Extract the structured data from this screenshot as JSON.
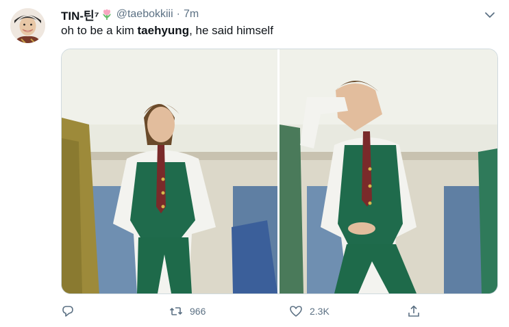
{
  "tweet": {
    "display_name": "TIN-틴⁷",
    "handle": "@taebokkiii",
    "separator": "·",
    "time": "7m",
    "text_before": "oh to be a kim ",
    "text_bold": "taehyung",
    "text_after": ", he said himself"
  },
  "actions": {
    "reply_count": "",
    "retweet_count": "966",
    "like_count": "2.3K",
    "share_count": ""
  },
  "icons": {
    "avatar": "user-avatar",
    "flower": "tulip-emoji-icon",
    "more": "chevron-down-icon",
    "reply": "reply-icon",
    "retweet": "retweet-icon",
    "like": "heart-icon",
    "share": "share-icon"
  },
  "colors": {
    "secondary_text": "#5b7083",
    "media_border": "#cfd9de",
    "vest_green": "#1f6b4c"
  }
}
